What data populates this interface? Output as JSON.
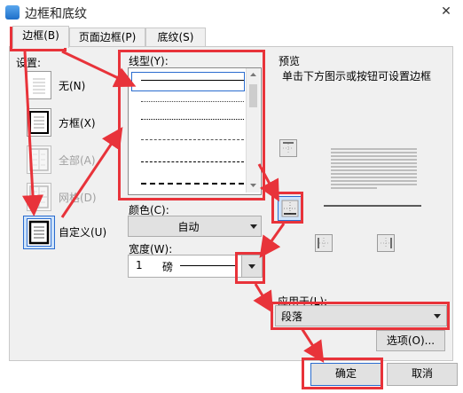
{
  "window": {
    "title": "边框和底纹",
    "close_label": "✕"
  },
  "tabs": [
    {
      "label": "边框(B)",
      "active": true
    },
    {
      "label": "页面边框(P)",
      "active": false
    },
    {
      "label": "底纹(S)",
      "active": false
    }
  ],
  "settings": {
    "label": "设置:",
    "items": [
      {
        "label": "无(N)",
        "enabled": true
      },
      {
        "label": "方框(X)",
        "enabled": true
      },
      {
        "label": "全部(A)",
        "enabled": false
      },
      {
        "label": "网格(D)",
        "enabled": false
      },
      {
        "label": "自定义(U)",
        "enabled": true,
        "selected": true
      }
    ]
  },
  "line_style": {
    "label": "线型(Y):",
    "styles": [
      "solid",
      "dotted-fine",
      "dotted",
      "dashed-small",
      "dashed",
      "dash-dot",
      "dash-dot-dot"
    ]
  },
  "color": {
    "label": "颜色(C):",
    "value": "自动"
  },
  "width": {
    "label": "宽度(W):",
    "value": "1",
    "unit": "磅"
  },
  "preview": {
    "label": "预览",
    "hint": "单击下方图示或按钮可设置边框"
  },
  "apply_to": {
    "label": "应用于(L):",
    "value": "段落"
  },
  "buttons": {
    "options": "选项(O)...",
    "ok": "确定",
    "cancel": "取消"
  },
  "colors": {
    "annotation_red": "#e8333a",
    "selection_blue": "#2a6ccf"
  }
}
